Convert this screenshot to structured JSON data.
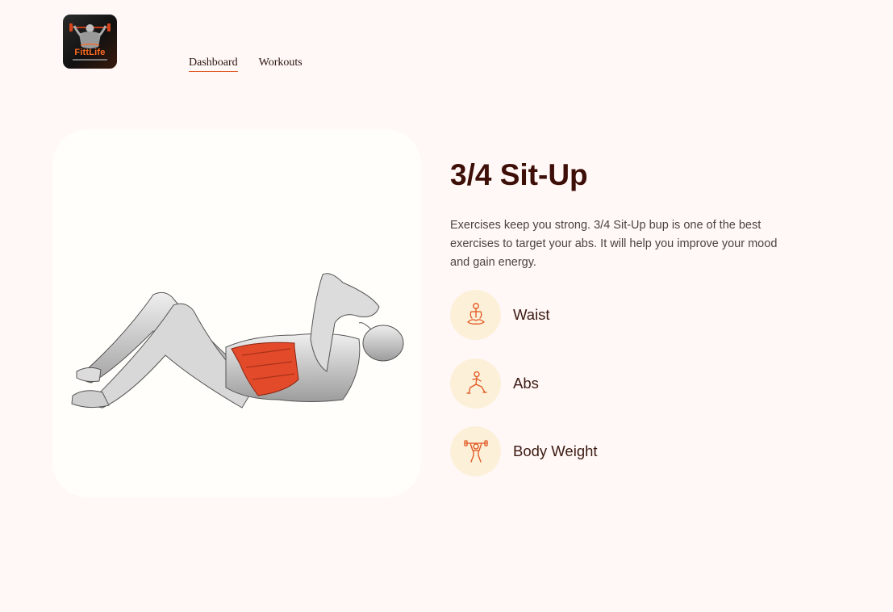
{
  "brand": {
    "name": "FittLife",
    "logo_icon": "bodybuilder-logo-icon"
  },
  "nav": {
    "items": [
      {
        "label": "Dashboard",
        "active": true
      },
      {
        "label": "Workouts",
        "active": false
      }
    ]
  },
  "exercise": {
    "image_icon": "sit-up-illustration",
    "title": "3/4 Sit-Up",
    "description": "Exercises keep you strong. 3/4 Sit-Up bup is one of the best exercises to target your abs. It will help you improve your mood and gain energy.",
    "tags": [
      {
        "label": "Waist",
        "icon": "meditation-icon"
      },
      {
        "label": "Abs",
        "icon": "lunge-icon"
      },
      {
        "label": "Body Weight",
        "icon": "weightlifter-icon"
      }
    ]
  },
  "colors": {
    "background": "#fff8f6",
    "accent": "#e0541e",
    "title": "#3d0f08",
    "tag_circle": "#fdf0d9",
    "muscle_highlight": "#e34a2a"
  }
}
